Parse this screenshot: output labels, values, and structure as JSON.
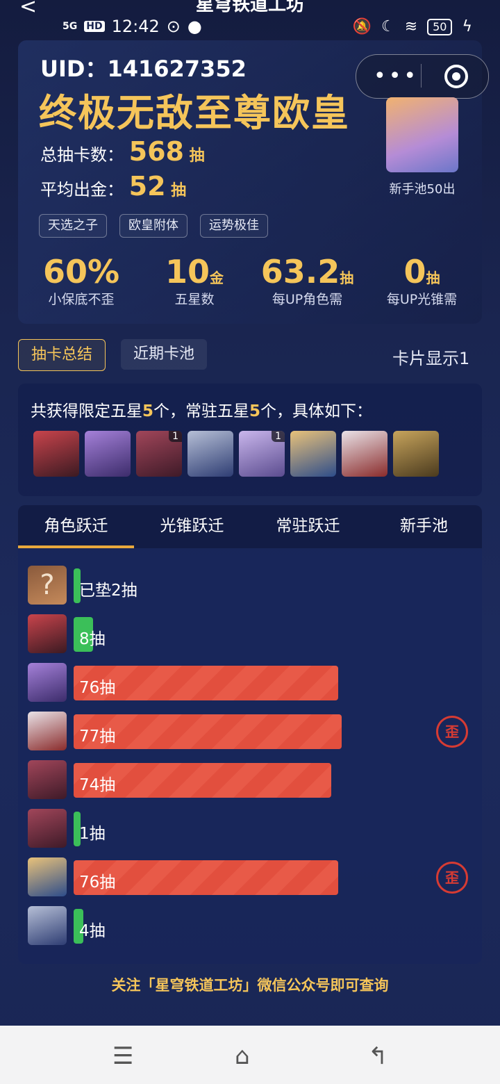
{
  "status_bar": {
    "network": "5G",
    "hd": "HD",
    "time": "12:42",
    "battery": "50"
  },
  "app_title": "星穹铁道工坊",
  "header": {
    "uid_label": "UID：141627352",
    "title": "终极无敌至尊欧皇",
    "total_label": "总抽卡数：",
    "total_value": "568",
    "total_unit": "抽",
    "avg_label": "平均出金：",
    "avg_value": "52",
    "avg_unit": "抽",
    "newbie_label": "新手池50出",
    "tags": [
      "天选之子",
      "欧皇附体",
      "运势极佳"
    ]
  },
  "kpis": [
    {
      "value": "60%",
      "unit": "",
      "label": "小保底不歪"
    },
    {
      "value": "10",
      "unit": "金",
      "label": "五星数"
    },
    {
      "value": "63.2",
      "unit": "抽",
      "label": "每UP角色需"
    },
    {
      "value": "0",
      "unit": "抽",
      "label": "每UP光锥需"
    }
  ],
  "view_tabs": {
    "active": "抽卡总结",
    "inactive": "近期卡池",
    "display": "卡片显示1"
  },
  "summary": {
    "prefix": "共获得限定五星",
    "limited": "5",
    "mid": "个，常驻五星",
    "standard": "5",
    "suffix": "个，具体如下："
  },
  "summary_avatars": [
    {
      "colors": [
        "#3b1a22",
        "#c9444c"
      ],
      "badge": ""
    },
    {
      "colors": [
        "#3c2c6b",
        "#a581d9"
      ],
      "badge": ""
    },
    {
      "colors": [
        "#3e1a28",
        "#a1465a"
      ],
      "badge": "1"
    },
    {
      "colors": [
        "#2e3d73",
        "#b6bfd6"
      ],
      "badge": ""
    },
    {
      "colors": [
        "#5b4c8f",
        "#c9b6ec"
      ],
      "badge": "1"
    },
    {
      "colors": [
        "#2e4d8a",
        "#e9c27a"
      ],
      "badge": ""
    },
    {
      "colors": [
        "#8a2b2b",
        "#e9e3e8"
      ],
      "badge": ""
    },
    {
      "colors": [
        "#4a3a1e",
        "#c7a45c"
      ],
      "badge": ""
    }
  ],
  "gacha_tabs": [
    "角色跃迁",
    "光锥跃迁",
    "常驻跃迁",
    "新手池"
  ],
  "pulls": [
    {
      "label": "已垫2抽",
      "count": 2,
      "type": "green",
      "lost": false,
      "unknown": true,
      "colors": [
        "#c58a5b",
        "#8a5a3c"
      ]
    },
    {
      "label": "8抽",
      "count": 8,
      "type": "green",
      "lost": false,
      "unknown": false,
      "colors": [
        "#3b1a22",
        "#c9444c"
      ]
    },
    {
      "label": "76抽",
      "count": 76,
      "type": "red",
      "lost": false,
      "unknown": false,
      "colors": [
        "#3c2c6b",
        "#a581d9"
      ]
    },
    {
      "label": "77抽",
      "count": 77,
      "type": "red",
      "lost": true,
      "unknown": false,
      "colors": [
        "#8a2b2b",
        "#e9e3e8"
      ]
    },
    {
      "label": "74抽",
      "count": 74,
      "type": "red",
      "lost": false,
      "unknown": false,
      "colors": [
        "#3e1a28",
        "#a1465a"
      ]
    },
    {
      "label": "1抽",
      "count": 1,
      "type": "green",
      "lost": false,
      "unknown": false,
      "colors": [
        "#3e1a28",
        "#a1465a"
      ]
    },
    {
      "label": "76抽",
      "count": 76,
      "type": "red",
      "lost": true,
      "unknown": false,
      "colors": [
        "#2e4d8a",
        "#e9c27a"
      ]
    },
    {
      "label": "4抽",
      "count": 4,
      "type": "green",
      "lost": false,
      "unknown": false,
      "colors": [
        "#2e3d73",
        "#b6bfd6"
      ]
    }
  ],
  "lost_stamp": "歪",
  "unknown_glyph": "?",
  "footer_note": "关注「星穹铁道工坊」微信公众号即可查询"
}
